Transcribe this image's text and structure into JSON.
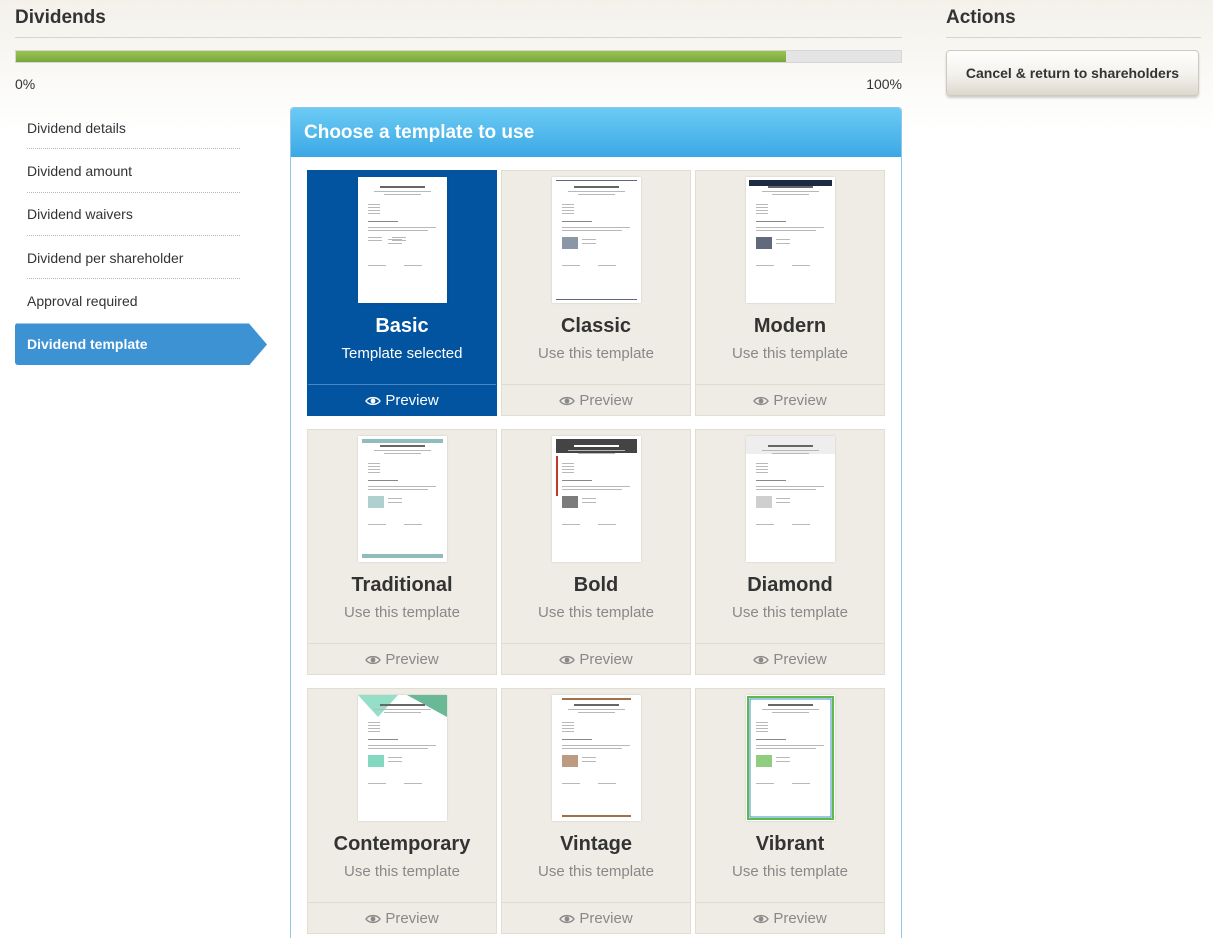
{
  "header": {
    "title": "Dividends"
  },
  "actions": {
    "title": "Actions",
    "cancel_label": "Cancel & return to shareholders"
  },
  "progress": {
    "value_percent": 87,
    "min_label": "0%",
    "max_label": "100%"
  },
  "steps": [
    {
      "label": "Dividend details",
      "active": false
    },
    {
      "label": "Dividend amount",
      "active": false
    },
    {
      "label": "Dividend waivers",
      "active": false
    },
    {
      "label": "Dividend per shareholder",
      "active": false
    },
    {
      "label": "Approval required",
      "active": false
    },
    {
      "label": "Dividend template",
      "active": true
    }
  ],
  "panel": {
    "title": "Choose a template to use"
  },
  "templates": [
    {
      "name": "Basic",
      "status": "Template selected",
      "preview": "Preview",
      "selected": true,
      "accent": "#333333"
    },
    {
      "name": "Classic",
      "status": "Use this template",
      "preview": "Preview",
      "selected": false,
      "accent": "#5a6a80"
    },
    {
      "name": "Modern",
      "status": "Use this template",
      "preview": "Preview",
      "selected": false,
      "accent": "#1c2b44"
    },
    {
      "name": "Traditional",
      "status": "Use this template",
      "preview": "Preview",
      "selected": false,
      "accent": "#8fbcbc"
    },
    {
      "name": "Bold",
      "status": "Use this template",
      "preview": "Preview",
      "selected": false,
      "accent": "#444444"
    },
    {
      "name": "Diamond",
      "status": "Use this template",
      "preview": "Preview",
      "selected": false,
      "accent": "#bbbbbb"
    },
    {
      "name": "Contemporary",
      "status": "Use this template",
      "preview": "Preview",
      "selected": false,
      "accent": "#4ec9a4"
    },
    {
      "name": "Vintage",
      "status": "Use this template",
      "preview": "Preview",
      "selected": false,
      "accent": "#a0704a"
    },
    {
      "name": "Vibrant",
      "status": "Use this template",
      "preview": "Preview",
      "selected": false,
      "accent": "#5fb84a"
    }
  ],
  "icons": {
    "preview": "eye-icon"
  },
  "colors": {
    "selected_tile": "#0254a0",
    "active_step": "#3c92d3",
    "progress_fill": "#8ab84a"
  }
}
